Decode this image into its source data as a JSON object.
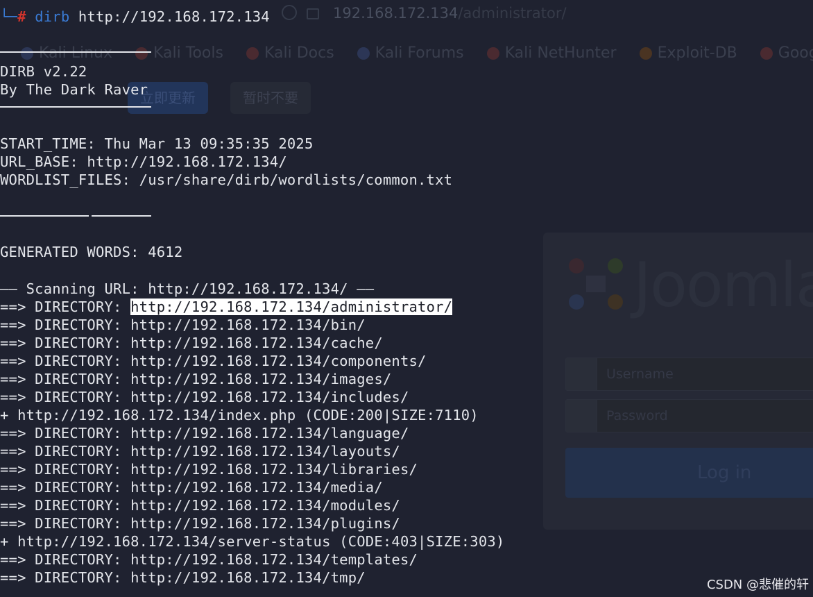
{
  "background_browser": {
    "url_host": "192.168.172.134",
    "url_path": "/administrator/",
    "bookmarks": [
      {
        "label": "Kali Linux",
        "icon": "kali-dragon-icon"
      },
      {
        "label": "Kali Tools",
        "icon": "kali-tools-icon"
      },
      {
        "label": "Kali Docs",
        "icon": "kali-docs-icon"
      },
      {
        "label": "Kali Forums",
        "icon": "kali-forums-icon"
      },
      {
        "label": "Kali NetHunter",
        "icon": "nethunter-icon"
      },
      {
        "label": "Exploit-DB",
        "icon": "exploit-db-icon"
      },
      {
        "label": "Google Hac",
        "icon": "google-hacking-icon"
      }
    ],
    "notice_update_button": "立即更新",
    "notice_later_button": "暂时不要",
    "login": {
      "logo_text": "Joomla",
      "username_placeholder": "Username",
      "password_placeholder": "Password",
      "login_button": "Log in"
    }
  },
  "terminal": {
    "prompt_prefix": "└─",
    "prompt_symbol": "#",
    "command_name": "dirb",
    "command_args": "http://192.168.172.134",
    "banner_title": "DIRB v2.22",
    "banner_author": "By The Dark Raver",
    "start_time": "START_TIME: Thu Mar 13 09:35:35 2025",
    "url_base": "URL_BASE: http://192.168.172.134/",
    "wordlist_files": "WORDLIST_FILES: /usr/share/dirb/wordlists/common.txt",
    "generated_words": "GENERATED WORDS: 4612",
    "scanning": "—— Scanning URL: http://192.168.172.134/ ——",
    "results": [
      {
        "prefix": "==> DIRECTORY: ",
        "url": "http://192.168.172.134/administrator/",
        "suffix": ""
      },
      {
        "prefix": "==> DIRECTORY: ",
        "url": "http://192.168.172.134/bin/",
        "suffix": ""
      },
      {
        "prefix": "==> DIRECTORY: ",
        "url": "http://192.168.172.134/cache/",
        "suffix": ""
      },
      {
        "prefix": "==> DIRECTORY: ",
        "url": "http://192.168.172.134/components/",
        "suffix": ""
      },
      {
        "prefix": "==> DIRECTORY: ",
        "url": "http://192.168.172.134/images/",
        "suffix": ""
      },
      {
        "prefix": "==> DIRECTORY: ",
        "url": "http://192.168.172.134/includes/",
        "suffix": ""
      },
      {
        "prefix": "+ ",
        "url": "http://192.168.172.134/index.php",
        "suffix": " (CODE:200|SIZE:7110)"
      },
      {
        "prefix": "==> DIRECTORY: ",
        "url": "http://192.168.172.134/language/",
        "suffix": ""
      },
      {
        "prefix": "==> DIRECTORY: ",
        "url": "http://192.168.172.134/layouts/",
        "suffix": ""
      },
      {
        "prefix": "==> DIRECTORY: ",
        "url": "http://192.168.172.134/libraries/",
        "suffix": ""
      },
      {
        "prefix": "==> DIRECTORY: ",
        "url": "http://192.168.172.134/media/",
        "suffix": ""
      },
      {
        "prefix": "==> DIRECTORY: ",
        "url": "http://192.168.172.134/modules/",
        "suffix": ""
      },
      {
        "prefix": "==> DIRECTORY: ",
        "url": "http://192.168.172.134/plugins/",
        "suffix": ""
      },
      {
        "prefix": "+ ",
        "url": "http://192.168.172.134/server-status",
        "suffix": " (CODE:403|SIZE:303)"
      },
      {
        "prefix": "==> DIRECTORY: ",
        "url": "http://192.168.172.134/templates/",
        "suffix": ""
      },
      {
        "prefix": "==> DIRECTORY: ",
        "url": "http://192.168.172.134/tmp/",
        "suffix": ""
      }
    ]
  },
  "watermark": "CSDN @悲催的轩",
  "colors": {
    "background": "#1f2230",
    "text": "#e3e5ea",
    "prompt_blue": "#3a7bd5",
    "prompt_red": "#d0342c",
    "highlight_bg": "#ffffff"
  }
}
